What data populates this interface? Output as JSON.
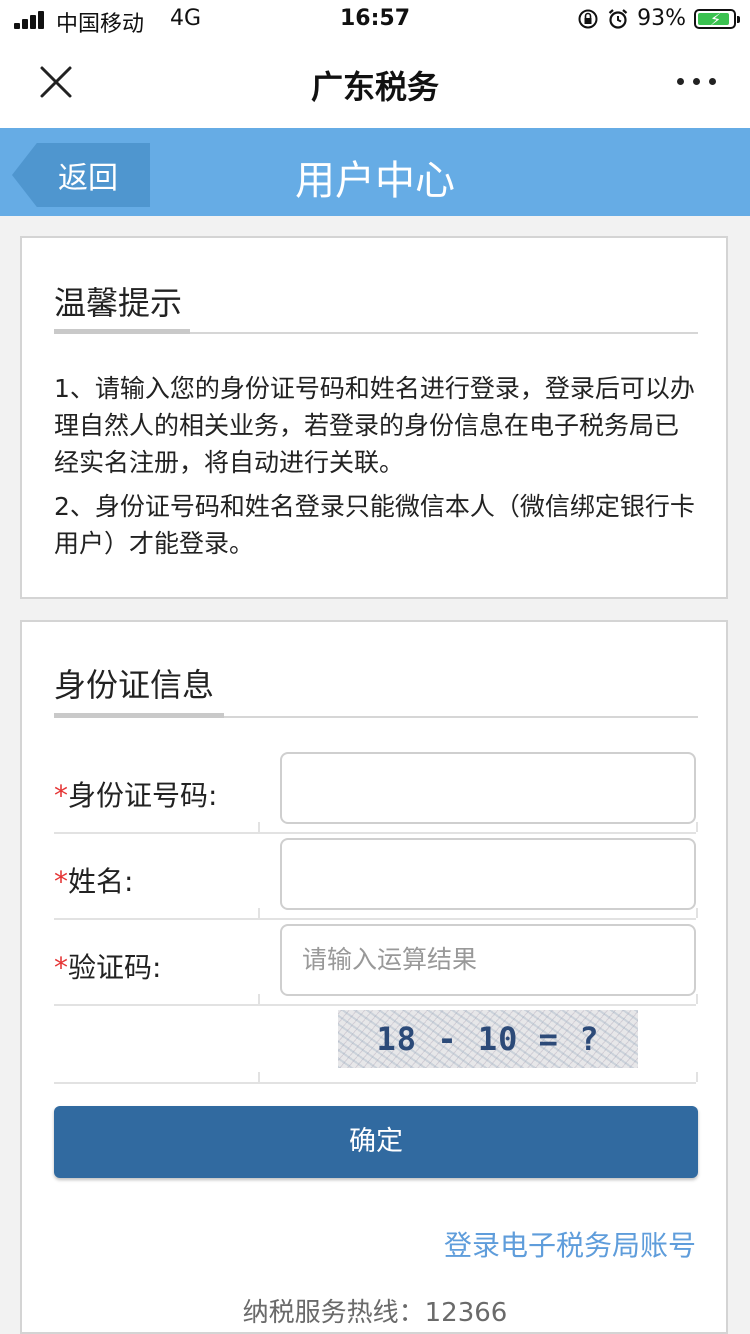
{
  "status_bar": {
    "carrier": "中国移动",
    "network": "4G",
    "time": "16:57",
    "battery": "93%",
    "battery_level": 0.93,
    "icons": [
      "signal-icon",
      "rotation-lock-icon",
      "alarm-icon",
      "battery-charging-icon"
    ]
  },
  "nav": {
    "title": "广东税务",
    "close_icon": "close-icon",
    "more_icon": "more-icon"
  },
  "header": {
    "back_label": "返回",
    "title": "用户中心",
    "color": "#66ace5"
  },
  "tips": {
    "title": "温馨提示",
    "items": [
      "1、请输入您的身份证号码和姓名进行登录，登录后可以办理自然人的相关业务，若登录的身份信息在电子税务局已经实名注册，将自动进行关联。",
      "2、身份证号码和姓名登录只能微信本人（微信绑定银行卡用户）才能登录。"
    ]
  },
  "id_form": {
    "title": "身份证信息",
    "required_mark": "*",
    "id_number": {
      "label": "身份证号码:",
      "value": ""
    },
    "name": {
      "label": "姓名:",
      "value": ""
    },
    "captcha": {
      "label": "验证码:",
      "placeholder": "请输入运算结果",
      "image_text": "18 - 10 = ?"
    },
    "confirm_label": "确定",
    "etax_link": "登录电子税务局账号"
  },
  "footer": {
    "hotline": "纳税服务热线：12366"
  }
}
